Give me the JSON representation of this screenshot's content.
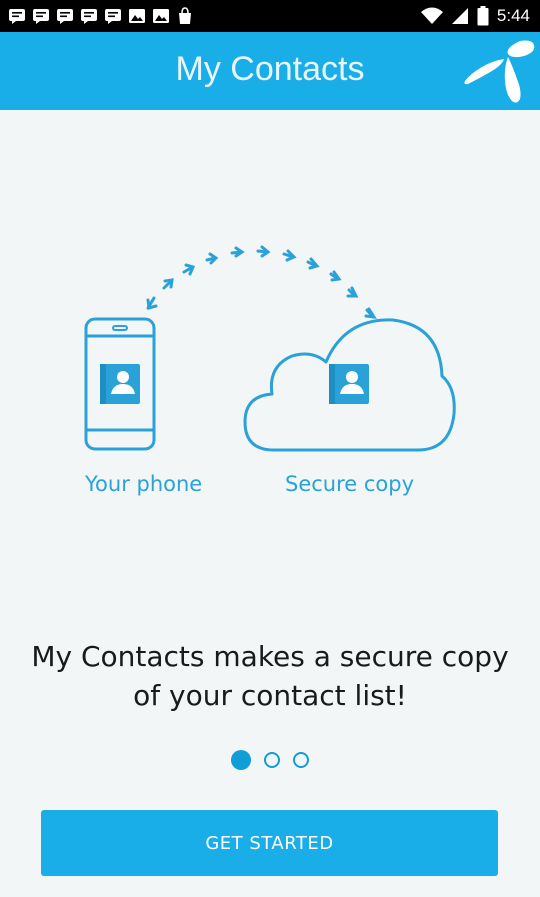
{
  "status_bar": {
    "time": "5:44",
    "notification_icons": [
      "message-icon",
      "message-icon",
      "message-icon",
      "message-icon",
      "message-icon",
      "image-icon",
      "image-icon",
      "shopping-bag-icon"
    ],
    "system_icons": [
      "wifi-icon",
      "signal-icon",
      "battery-icon"
    ]
  },
  "app_bar": {
    "title": "My Contacts",
    "logo": "telenor-logo"
  },
  "illustration": {
    "phone_label": "Your phone",
    "cloud_label": "Secure copy"
  },
  "onboarding": {
    "headline": "My Contacts makes a secure copy of your contact list!",
    "page_count": 3,
    "current_page": 1
  },
  "actions": {
    "get_started_label": "GET STARTED"
  },
  "colors": {
    "primary": "#19aee8",
    "accent": "#2aa2d8",
    "background": "#f3f6f6"
  }
}
